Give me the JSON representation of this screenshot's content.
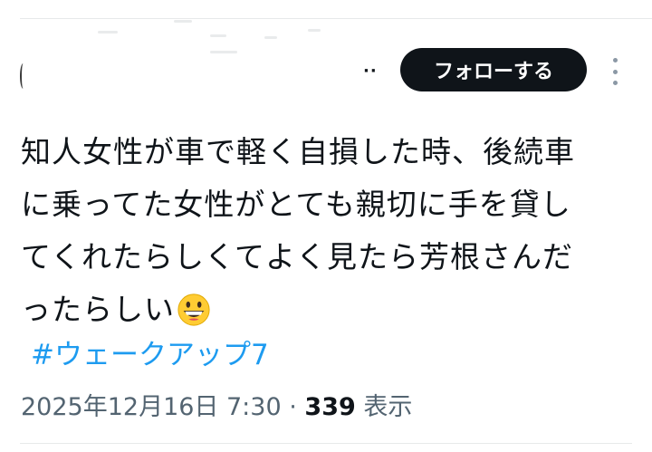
{
  "header": {
    "more_inline": "··",
    "follow_label": "フォローする",
    "more_menu_icon": "more-vertical-icon"
  },
  "tweet": {
    "lines": [
      "知人女性が車で軽く自損した時、後続車",
      "に乗ってた女性がとても親切に手を貸し",
      "てくれたらしくてよく見たら芳根さんだ",
      "ったらしい"
    ],
    "emoji": "grinning-face-icon",
    "hashtag": "#ウェークアップ7"
  },
  "meta": {
    "timestamp": "2025年12月16日 7:30",
    "separator": "·",
    "views_count": "339",
    "views_label": "表示"
  },
  "colors": {
    "text": "#0f1419",
    "secondary": "#536471",
    "link": "#1d9bf0",
    "button_bg": "#0f1419",
    "divider": "#e7e9ea"
  }
}
